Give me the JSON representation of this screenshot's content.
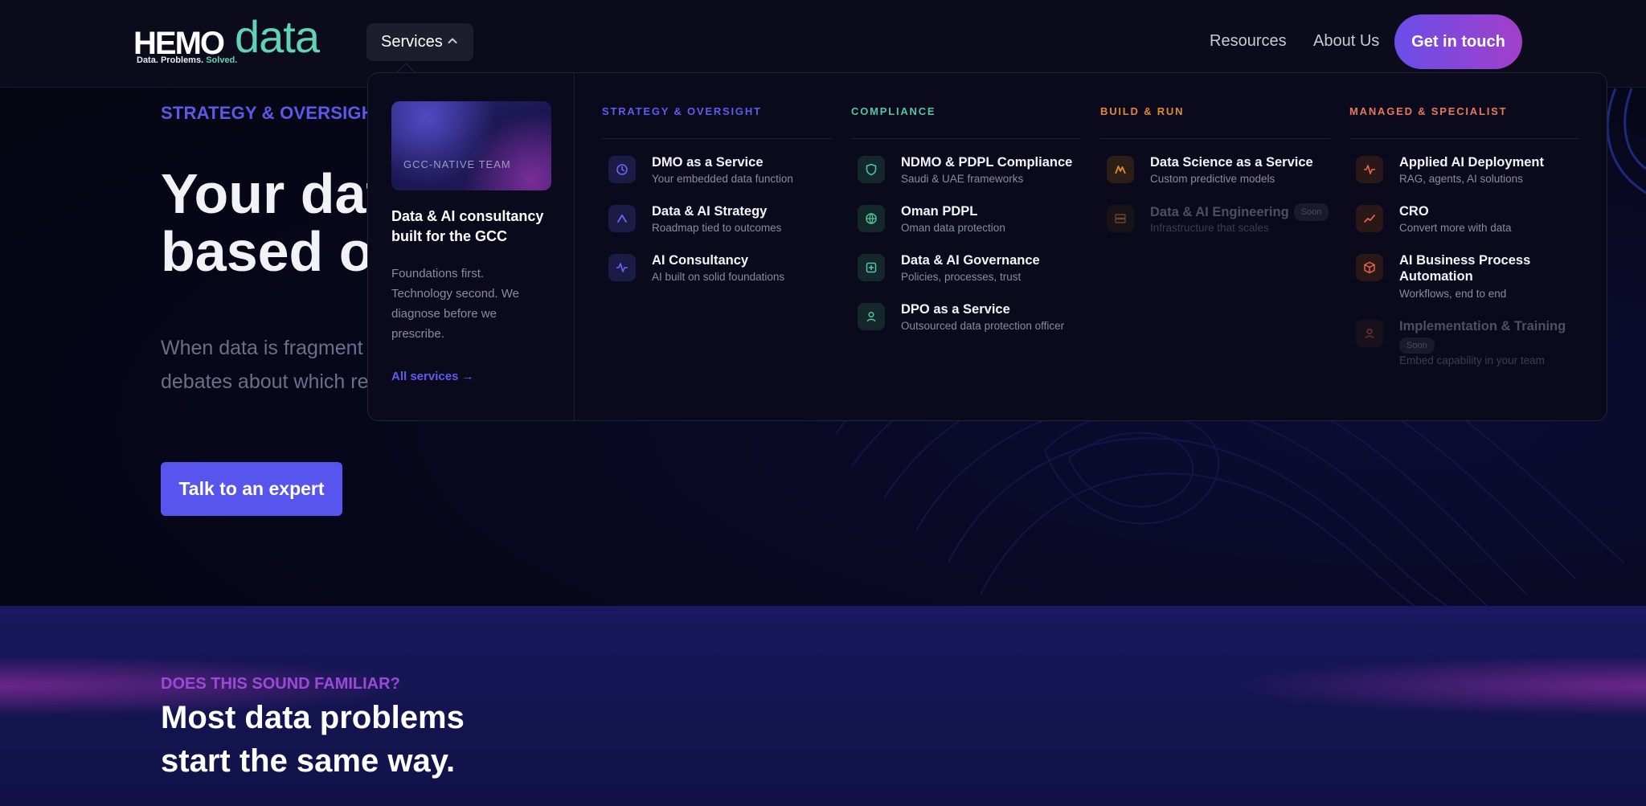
{
  "nav": {
    "logo": {
      "word1": "HEMO",
      "word2": "data",
      "tagline_start": "Data. Problems.",
      "tagline_end": "Solved."
    },
    "services_label": "Services",
    "links": [
      "Resources",
      "About Us"
    ],
    "cta_label": "Get in touch"
  },
  "hero": {
    "eyebrow": "STRATEGY & OVERSIGHT",
    "title_lines": [
      "Your dat",
      "based or"
    ],
    "subtitle_lines": [
      "When data is fragment",
      "debates about which re"
    ],
    "cta_label": "Talk to an expert"
  },
  "dropdown": {
    "feature": {
      "image_label": "GCC-NATIVE TEAM",
      "title": "Data & AI consultancy built for the GCC",
      "description": "Foundations first. Technology second. We diagnose before we prescribe.",
      "link_label": "All services →"
    },
    "columns": [
      {
        "heading": "STRATEGY & OVERSIGHT",
        "color": "#5f5cf0",
        "items": [
          {
            "title": "DMO as a Service",
            "sub": "Your embedded data function",
            "icon": "clock-icon"
          },
          {
            "title": "Data & AI Strategy",
            "sub": "Roadmap tied to outcomes",
            "icon": "chevron-up-icon"
          },
          {
            "title": "AI Consultancy",
            "sub": "AI built on solid foundations",
            "icon": "pulse-icon"
          }
        ]
      },
      {
        "heading": "COMPLIANCE",
        "color": "#4fc7a4",
        "items": [
          {
            "title": "NDMO & PDPL Compliance",
            "sub": "Saudi & UAE frameworks",
            "icon": "shield-icon"
          },
          {
            "title": "Oman PDPL",
            "sub": "Oman data protection",
            "icon": "globe-icon"
          },
          {
            "title": "Data & AI Governance",
            "sub": "Policies, processes, trust",
            "icon": "plus-square-icon"
          },
          {
            "title": "DPO as a Service",
            "sub": "Outsourced data protection officer",
            "icon": "person-icon"
          }
        ]
      },
      {
        "heading": "BUILD & RUN",
        "color": "#e08a2e",
        "items": [
          {
            "title": "Data Science as a Service",
            "sub": "Custom predictive models",
            "icon": "chart-peak-icon"
          },
          {
            "title": "Data & AI Engineering",
            "badge": "Soon",
            "sub": "Infrastructure that scales",
            "icon": "server-icon"
          }
        ]
      },
      {
        "heading": "MANAGED & SPECIALIST",
        "color": "#e8775c",
        "items": [
          {
            "title": "Applied AI Deployment",
            "sub": "RAG, agents, AI solutions",
            "icon": "pulse-icon"
          },
          {
            "title": "CRO",
            "sub": "Convert more with data",
            "icon": "trend-up-icon"
          },
          {
            "title_lines": [
              "AI Business Process",
              "Automation"
            ],
            "sub": "Workflows, end to end",
            "icon": "cube-icon"
          },
          {
            "title": "Implementation & Training",
            "badge": "Soon",
            "sub": "Embed capability in your team",
            "icon": "person-icon"
          }
        ]
      }
    ]
  },
  "section2": {
    "eyebrow": "DOES THIS SOUND FAMILIAR?",
    "title_lines": [
      "Most data problems",
      "start the same way."
    ]
  }
}
